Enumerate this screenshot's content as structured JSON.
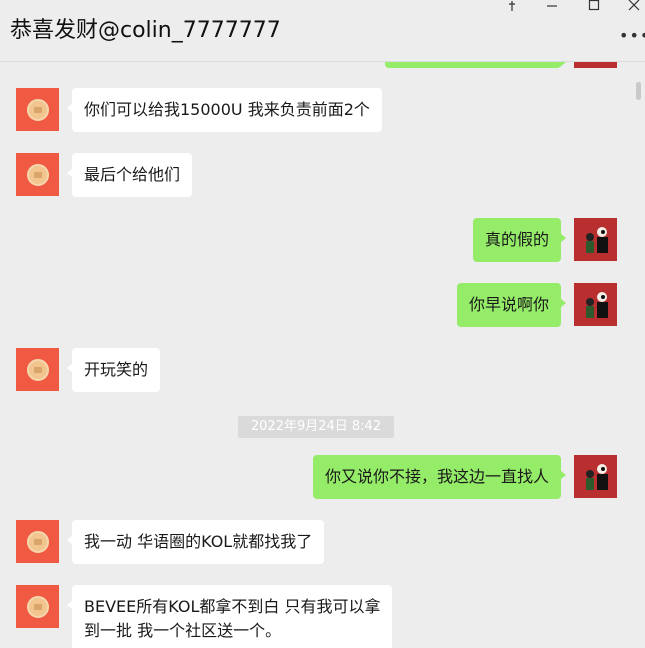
{
  "window": {
    "title": "恭喜发财@colin_7777777",
    "pin_icon": "pin-icon",
    "minimize_icon": "minimize-icon",
    "maximize_icon": "maximize-icon",
    "close_icon": "close-icon",
    "more_icon": "more-icon"
  },
  "messages": [
    {
      "side": "in",
      "text": "你们可以给我15000U 我来负责前面2个"
    },
    {
      "side": "in",
      "text": "最后个给他们"
    },
    {
      "side": "out",
      "text": "真的假的"
    },
    {
      "side": "out",
      "text": "你早说啊你"
    },
    {
      "side": "in",
      "text": "开玩笑的"
    },
    {
      "side": "out",
      "text": "你又说你不接，我这边一直找人"
    },
    {
      "side": "in",
      "text": "我一动 华语圈的KOL就都找我了"
    },
    {
      "side": "in",
      "text": "BEVEE所有KOL都拿不到白  只有我可以拿",
      "text2": "到一批 我一个社区送一个。"
    }
  ],
  "timestamp": "2022年9月24日 8:42",
  "colors": {
    "background": "#ededed",
    "incoming_bubble": "#ffffff",
    "outgoing_bubble": "#95ec69",
    "left_avatar": "#f05a42",
    "right_avatar": "#b92e2e"
  }
}
